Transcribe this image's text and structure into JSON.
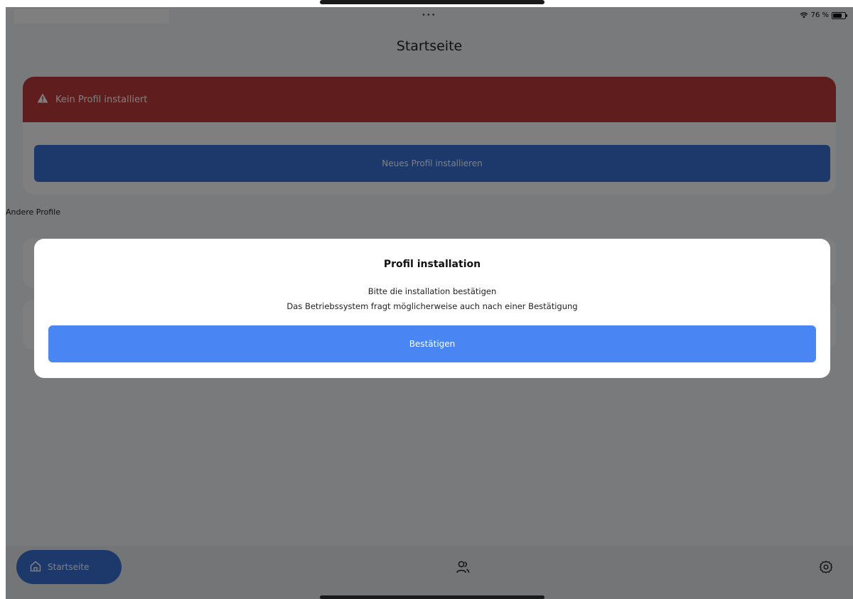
{
  "status_bar": {
    "dots": "•••",
    "battery": "76 %"
  },
  "header": {
    "title": "Startseite"
  },
  "alert": {
    "text": "Kein Profil installiert"
  },
  "install_button": {
    "label": "Neues Profil installieren"
  },
  "other_profiles": {
    "label": "Andere Profile"
  },
  "dialog": {
    "title": "Profil installation",
    "line1": "Bitte die installation bestätigen",
    "line2": "Das Betriebssystem fragt möglicherweise auch nach einer Bestätigung",
    "confirm_label": "Bestätigen"
  },
  "bottom_nav": {
    "home_label": "Startseite"
  },
  "icons": {
    "alert": "warning-triangle-icon",
    "home": "home-icon",
    "profiles": "users-icon",
    "settings": "gear-icon",
    "wifi": "wifi-icon",
    "battery": "battery-icon"
  },
  "colors": {
    "alert_red": "#c03a3a",
    "primary_blue": "#3a72d6",
    "confirm_blue": "#4a86f3"
  }
}
